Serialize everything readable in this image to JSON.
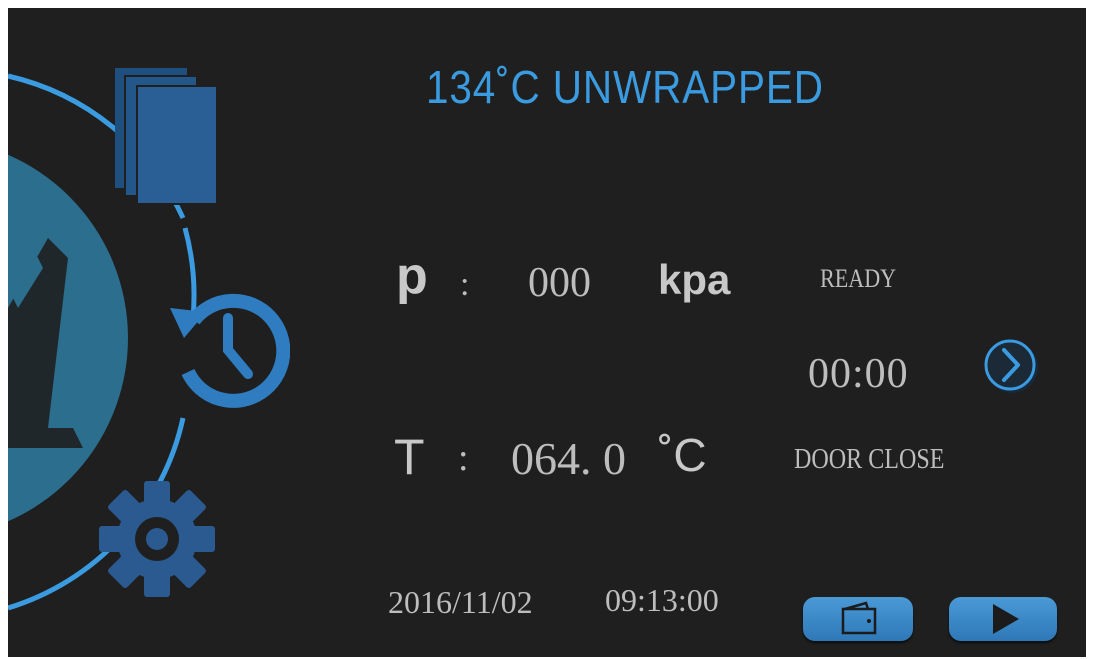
{
  "program": {
    "temperature": "134",
    "unit": "˚C",
    "name": "UNWRAPPED"
  },
  "pressure": {
    "label": "p",
    "separator": ":",
    "value": "000",
    "unit": "kpa"
  },
  "temperature_reading": {
    "label": "T",
    "separator": ":",
    "value": "064. 0",
    "unit": "˚C"
  },
  "status": {
    "state": "READY",
    "timer": "00:00",
    "door": "DOOR CLOSE"
  },
  "datetime": {
    "date": "2016/11/02",
    "time": "09:13:00"
  },
  "icons": {
    "documents": "documents-icon",
    "history": "history-icon",
    "settings": "gear-icon",
    "next": "chevron-right-icon",
    "wallet": "wallet-icon",
    "start": "play-icon"
  },
  "colors": {
    "background": "#1f1f1f",
    "accent": "#3b9be0",
    "icon_blue": "#2a5a8f",
    "text": "#bdbdbd"
  }
}
